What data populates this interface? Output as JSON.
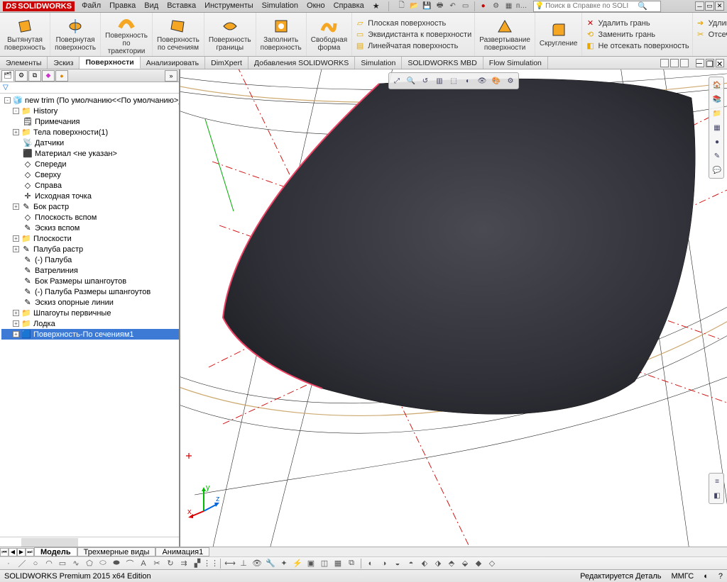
{
  "app": {
    "name": "SOLIDWORKS",
    "logo_prefix": "DS"
  },
  "menu": [
    "Файл",
    "Правка",
    "Вид",
    "Вставка",
    "Инструменты",
    "Simulation",
    "Окно",
    "Справка",
    "★"
  ],
  "search": {
    "placeholder": "Поиск в Справке по SOLI"
  },
  "titlebar_short": "п…",
  "ribbon_large": [
    {
      "label": "Вытянутая\nповерхность"
    },
    {
      "label": "Повернутая\nповерхность"
    },
    {
      "label": "Поверхность\nпо\nтраектории"
    },
    {
      "label": "Поверхность\nпо сечениям"
    },
    {
      "label": "Поверхность\nграницы"
    },
    {
      "label": "Заполнить\nповерхность"
    },
    {
      "label": "Свободная\nформа"
    }
  ],
  "ribbon_mid1": [
    "Плоская поверхность",
    "Эквидистанта к поверхности",
    "Линейчатая поверхность"
  ],
  "ribbon_mid2": [
    {
      "label": "Развертывание\nповерхности"
    },
    {
      "label": "Скругление"
    }
  ],
  "ribbon_right1": [
    "Удалить грань",
    "Заменить грань",
    "Не отсекать поверхность"
  ],
  "ribbon_right2": [
    "Удлинить поверхность",
    "Отсечь поверхность",
    ""
  ],
  "cmd_tabs": [
    "Элементы",
    "Эскиз",
    "Поверхности",
    "Анализировать",
    "DimXpert",
    "Добавления SOLIDWORKS",
    "Simulation",
    "SOLIDWORKS MBD",
    "Flow Simulation"
  ],
  "cmd_active": 2,
  "doc_title": "new trim  (По умолчанию<<По умолчанию>_Со",
  "tree": [
    {
      "exp": "-",
      "ico": "folder",
      "txt": "History",
      "ind": 1
    },
    {
      "exp": "",
      "ico": "note",
      "txt": "Примечания",
      "ind": 1
    },
    {
      "exp": "+",
      "ico": "folder",
      "txt": "Тела поверхности(1)",
      "ind": 1
    },
    {
      "exp": "",
      "ico": "sensor",
      "txt": "Датчики",
      "ind": 1
    },
    {
      "exp": "",
      "ico": "mat",
      "txt": "Материал <не указан>",
      "ind": 1
    },
    {
      "exp": "",
      "ico": "plane",
      "txt": "Спереди",
      "ind": 1
    },
    {
      "exp": "",
      "ico": "plane",
      "txt": "Сверху",
      "ind": 1
    },
    {
      "exp": "",
      "ico": "plane",
      "txt": "Справа",
      "ind": 1
    },
    {
      "exp": "",
      "ico": "origin",
      "txt": "Исходная точка",
      "ind": 1
    },
    {
      "exp": "+",
      "ico": "sketch",
      "txt": "Бок растр",
      "ind": 1
    },
    {
      "exp": "",
      "ico": "plane",
      "txt": "Плоскость вспом",
      "ind": 1
    },
    {
      "exp": "",
      "ico": "sketch",
      "txt": "Эскиз вспом",
      "ind": 1
    },
    {
      "exp": "+",
      "ico": "folder",
      "txt": "Плоскости",
      "ind": 1
    },
    {
      "exp": "+",
      "ico": "sketch",
      "txt": "Палуба растр",
      "ind": 1
    },
    {
      "exp": "",
      "ico": "sketch",
      "txt": "(-) Палуба",
      "ind": 1
    },
    {
      "exp": "",
      "ico": "sketch",
      "txt": "Ватрелиния",
      "ind": 1
    },
    {
      "exp": "",
      "ico": "sketch",
      "txt": "Бок Размеры шпангоутов",
      "ind": 1
    },
    {
      "exp": "",
      "ico": "sketch",
      "txt": "(-) Палуба Размеры шпангоутов",
      "ind": 1
    },
    {
      "exp": "",
      "ico": "sketch",
      "txt": "Эскиз опорные линии",
      "ind": 1
    },
    {
      "exp": "+",
      "ico": "folder",
      "txt": "Шпагоуты первичные",
      "ind": 1
    },
    {
      "exp": "+",
      "ico": "folder",
      "txt": "Лодка",
      "ind": 1
    },
    {
      "exp": "+",
      "ico": "loft",
      "txt": "Поверхность-По сечениям1",
      "ind": 1,
      "sel": true
    }
  ],
  "bottom_tabs": [
    "Модель",
    "Трехмерные виды",
    "Анимация1"
  ],
  "bottom_active": 0,
  "status": {
    "left": "SOLIDWORKS Premium 2015 x64 Edition",
    "mode": "Редактируется Деталь",
    "units": "ММГС"
  },
  "triad": {
    "x": "x",
    "y": "y",
    "z": "z"
  }
}
